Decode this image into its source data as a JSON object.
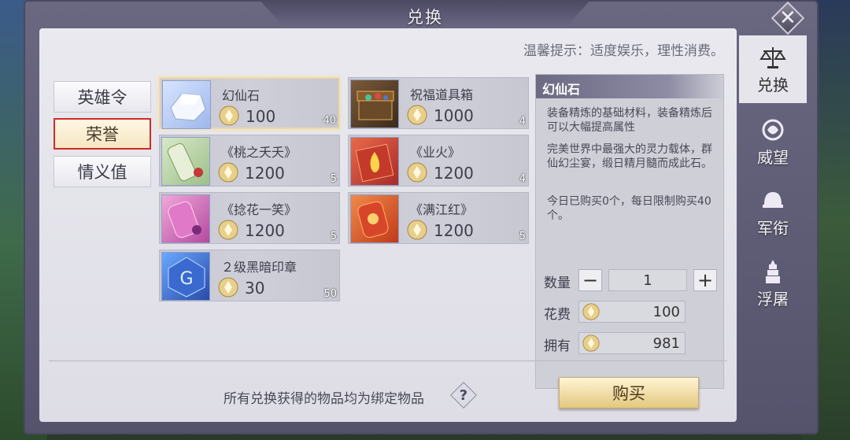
{
  "window": {
    "title": "兑换",
    "close_label": "✕"
  },
  "hint": "温馨提示：适度娱乐，理性消费。",
  "left_tabs": [
    {
      "label": "英雄令",
      "active": false
    },
    {
      "label": "荣誉",
      "active": true
    },
    {
      "label": "情义值",
      "active": false
    }
  ],
  "items": [
    {
      "name": "幻仙石",
      "price": "100",
      "count": "40",
      "icon": "white-crystal-icon",
      "selected": true
    },
    {
      "name": "祝福道具箱",
      "price": "1000",
      "count": "4",
      "icon": "treasure-chest-icon",
      "selected": false
    },
    {
      "name": "《桃之夭夭》",
      "price": "1200",
      "count": "5",
      "icon": "green-scroll-icon",
      "selected": false
    },
    {
      "name": "《业火》",
      "price": "1200",
      "count": "4",
      "icon": "fire-book-icon",
      "selected": false
    },
    {
      "name": "《捻花一笑》",
      "price": "1200",
      "count": "5",
      "icon": "pink-scroll-icon",
      "selected": false
    },
    {
      "name": "《满江红》",
      "price": "1200",
      "count": "5",
      "icon": "red-scroll-icon",
      "selected": false
    },
    {
      "name": "２级黑暗印章",
      "price": "30",
      "count": "50",
      "icon": "dark-seal-icon",
      "selected": false
    }
  ],
  "detail": {
    "title": "幻仙石",
    "desc1": "装备精炼的基础材料，装备精炼后可以大幅提高属性",
    "desc2": "完美世界中最强大的灵力载体，群仙幻尘宴，缎日精月髓而成此石。",
    "desc3": "今日已购买0个，每日限制购买40个。",
    "qty_label": "数量",
    "qty_value": "1",
    "minus": "−",
    "plus": "+",
    "cost_label": "花费",
    "cost_value": "100",
    "own_label": "拥有",
    "own_value": "981"
  },
  "bottom": {
    "note": "所有兑换获得的物品均为绑定物品",
    "help": "?",
    "buy_label": "购买"
  },
  "right_tabs": [
    {
      "label": "兑换",
      "icon": "scales-icon",
      "active": true
    },
    {
      "label": "威望",
      "icon": "emblem-icon",
      "active": false
    },
    {
      "label": "军衔",
      "icon": "helmet-icon",
      "active": false
    },
    {
      "label": "浮屠",
      "icon": "pagoda-icon",
      "active": false
    }
  ],
  "colors": {
    "accent_red": "#d12a2a",
    "panel_bg": "#e9e9ef",
    "button_gold": "#efd9a0"
  }
}
